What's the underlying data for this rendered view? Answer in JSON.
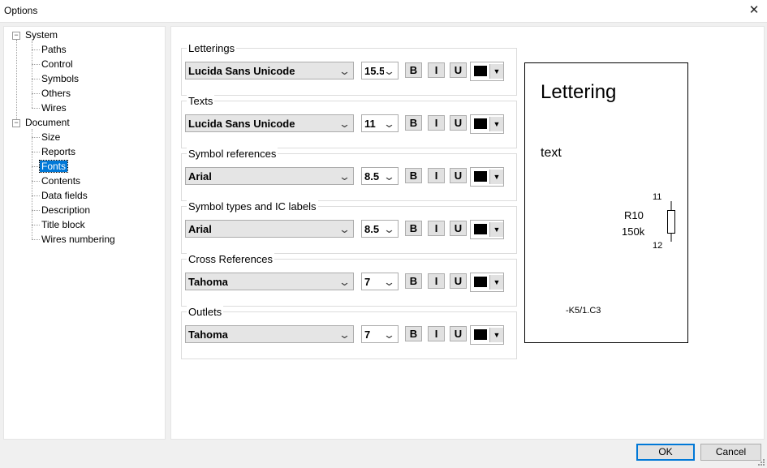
{
  "window": {
    "title": "Options",
    "close_glyph": "✕"
  },
  "tree": {
    "system": {
      "label": "System",
      "children": [
        "Paths",
        "Control",
        "Symbols",
        "Others",
        "Wires"
      ]
    },
    "document": {
      "label": "Document",
      "children": [
        "Size",
        "Reports",
        "Fonts",
        "Contents",
        "Data fields",
        "Description",
        "Title block",
        "Wires numbering"
      ]
    },
    "selected": "Fonts"
  },
  "font_groups": [
    {
      "label": "Letterings",
      "font": "Lucida Sans Unicode",
      "size": "15.5"
    },
    {
      "label": "Texts",
      "font": "Lucida Sans Unicode",
      "size": "11"
    },
    {
      "label": "Symbol references",
      "font": "Arial",
      "size": "8.5"
    },
    {
      "label": "Symbol types and IC labels",
      "font": "Arial",
      "size": "8.5"
    },
    {
      "label": "Cross References",
      "font": "Tahoma",
      "size": "7"
    },
    {
      "label": "Outlets",
      "font": "Tahoma",
      "size": "7"
    }
  ],
  "style_buttons": {
    "bold": "B",
    "italic": "I",
    "underline": "U"
  },
  "colors": {
    "font_color": "#000000",
    "accent": "#0078d7"
  },
  "preview": {
    "lettering": "Lettering",
    "text": "text",
    "pin_top": "11",
    "pin_bottom": "12",
    "ref": "R10",
    "value": "150k",
    "cross_ref": "-K5/1.C3"
  },
  "buttons": {
    "ok": "OK",
    "cancel": "Cancel"
  }
}
